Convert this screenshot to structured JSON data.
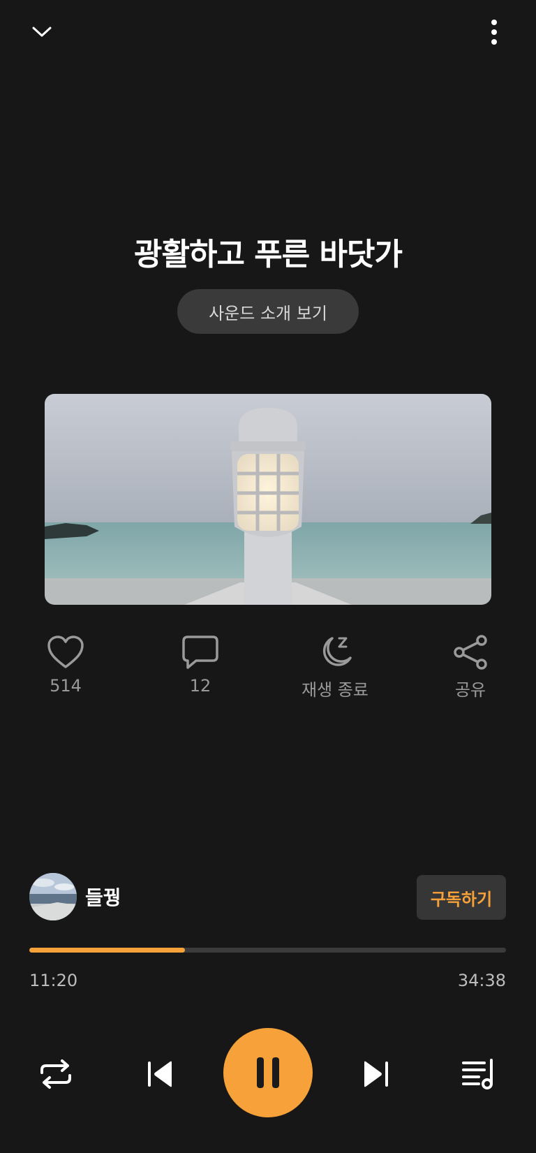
{
  "header": {
    "collapse_icon": "chevron-down-icon",
    "more_icon": "more-vertical-icon"
  },
  "track": {
    "title": "광활하고 푸른 바닷가",
    "intro_button_label": "사운드 소개 보기"
  },
  "actions": {
    "like": {
      "icon": "heart-icon",
      "label": "514"
    },
    "comment": {
      "icon": "comment-icon",
      "label": "12"
    },
    "sleep_timer": {
      "icon": "moon-sleep-icon",
      "label": "재생 종료"
    },
    "share": {
      "icon": "share-icon",
      "label": "공유"
    }
  },
  "channel": {
    "name": "들꿩",
    "subscribe_label": "구독하기"
  },
  "player": {
    "current_time": "11:20",
    "total_time": "34:38",
    "progress_fraction": 0.327
  },
  "colors": {
    "accent": "#f7a13a",
    "background": "#171717",
    "pill": "#3a3a3a"
  }
}
